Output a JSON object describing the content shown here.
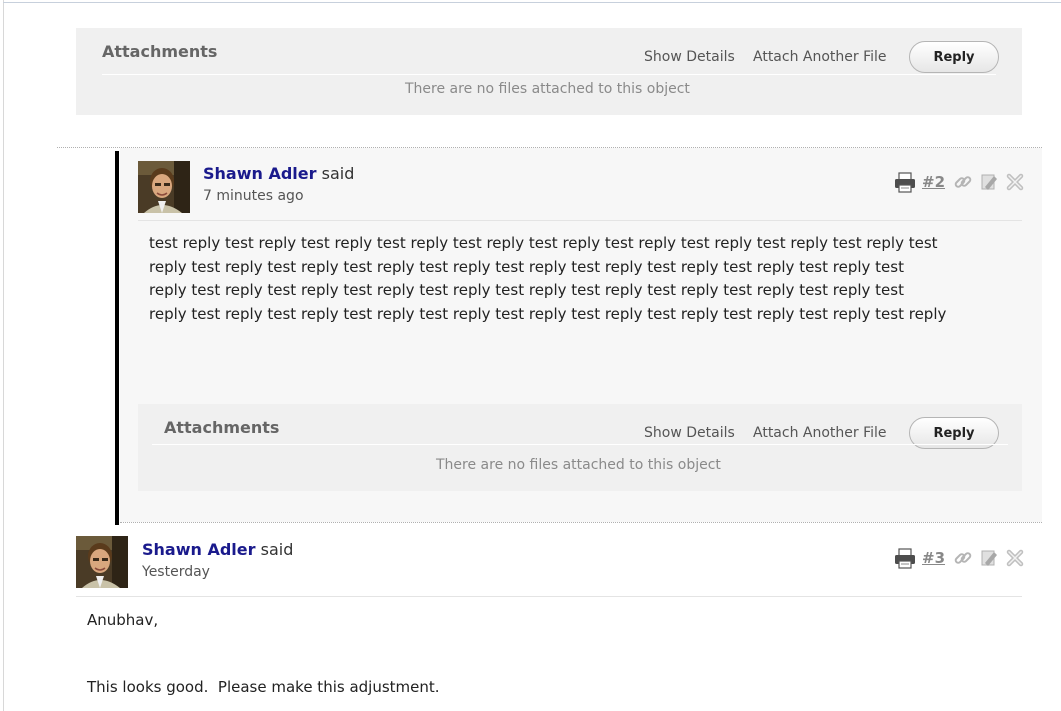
{
  "top_attachments": {
    "title": "Attachments",
    "show_details": "Show Details",
    "attach_another": "Attach Another File",
    "reply": "Reply",
    "empty_message": "There are no files attached to this object"
  },
  "comments": [
    {
      "author": "Shawn Adler",
      "said": "said",
      "time": "7 minutes ago",
      "number": "#2",
      "body_lines": [
        "test reply test reply test reply test reply test reply test reply test reply test reply test reply test reply test",
        "reply test reply test reply test reply test reply test reply test reply test reply test reply test reply test",
        "reply test reply test reply test reply test reply test reply test reply test reply test reply test reply test",
        "reply test reply test reply test reply test reply test reply test reply test reply test reply test reply test reply"
      ],
      "attachments": {
        "title": "Attachments",
        "show_details": "Show Details",
        "attach_another": "Attach Another File",
        "reply": "Reply",
        "empty_message": "There are no files attached to this object"
      }
    },
    {
      "author": "Shawn Adler",
      "said": "said",
      "time": "Yesterday",
      "number": "#3",
      "body_lines": [
        "Anubhav,",
        "This looks good.  Please make this adjustment."
      ]
    }
  ],
  "icons": [
    "print-icon",
    "permalink-icon",
    "edit-icon",
    "delete-icon"
  ]
}
